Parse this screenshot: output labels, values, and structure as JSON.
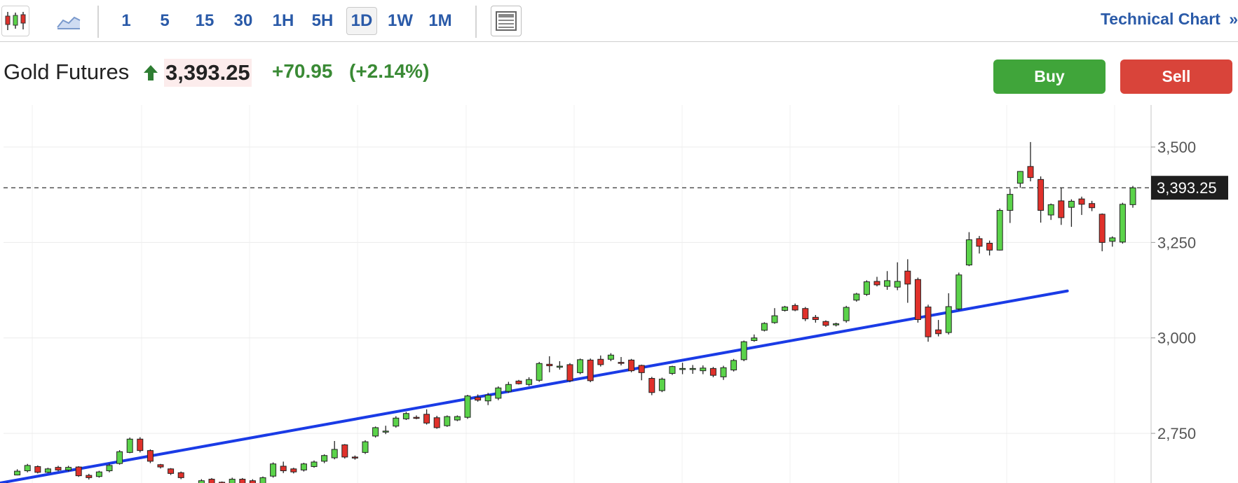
{
  "toolbar": {
    "candles_icon": "candlestick-icon",
    "area_icon": "area-chart-icon",
    "timeframes": [
      "1",
      "5",
      "15",
      "30",
      "1H",
      "5H",
      "1D",
      "1W",
      "1M"
    ],
    "active_timeframe": "1D",
    "layout_icon": "layout-icon",
    "technical_label": "Technical Chart",
    "technical_arrow": "»"
  },
  "header": {
    "title": "Gold Futures",
    "price": "3,393.25",
    "change": "+70.95",
    "change_pct": "(+2.14%)",
    "buy_label": "Buy",
    "sell_label": "Sell"
  },
  "colors": {
    "up": "#5bd34a",
    "down": "#e0312b",
    "trendline": "#1a3be6",
    "accent": "#2a5aa8"
  },
  "chart_data": {
    "type": "candlestick",
    "current_price": 3393.25,
    "current_price_label": "3,393.25",
    "y_ticks": [
      2750,
      3000,
      3250,
      3500
    ],
    "y_tick_labels": [
      "2,750",
      "3,000",
      "3,250",
      "3,500"
    ],
    "ylim": [
      2620,
      3610
    ],
    "trendline": {
      "start": [
        0,
        2620
      ],
      "end": [
        81,
        3123
      ]
    },
    "candles": [
      [
        2617,
        2619,
        2610,
        2621
      ],
      [
        2641,
        2651,
        2640,
        2656
      ],
      [
        2652,
        2666,
        2648,
        2670
      ],
      [
        2663,
        2648,
        2645,
        2666
      ],
      [
        2648,
        2657,
        2646,
        2660
      ],
      [
        2661,
        2654,
        2651,
        2665
      ],
      [
        2654,
        2661,
        2650,
        2665
      ],
      [
        2662,
        2639,
        2636,
        2664
      ],
      [
        2640,
        2634,
        2629,
        2644
      ],
      [
        2637,
        2649,
        2634,
        2652
      ],
      [
        2652,
        2666,
        2648,
        2671
      ],
      [
        2671,
        2702,
        2668,
        2706
      ],
      [
        2700,
        2735,
        2698,
        2739
      ],
      [
        2735,
        2705,
        2700,
        2740
      ],
      [
        2705,
        2677,
        2672,
        2708
      ],
      [
        2668,
        2662,
        2658,
        2670
      ],
      [
        2657,
        2645,
        2641,
        2659
      ],
      [
        2647,
        2634,
        2630,
        2650
      ],
      [
        2612,
        2607,
        2600,
        2615
      ],
      [
        2609,
        2626,
        2606,
        2630
      ],
      [
        2630,
        2617,
        2614,
        2633
      ],
      [
        2622,
        2620,
        2618,
        2624
      ],
      [
        2617,
        2630,
        2614,
        2634
      ],
      [
        2630,
        2610,
        2606,
        2633
      ],
      [
        2626,
        2608,
        2604,
        2630
      ],
      [
        2611,
        2634,
        2606,
        2637
      ],
      [
        2638,
        2670,
        2634,
        2674
      ],
      [
        2664,
        2652,
        2646,
        2676
      ],
      [
        2657,
        2649,
        2645,
        2660
      ],
      [
        2654,
        2670,
        2650,
        2673
      ],
      [
        2663,
        2675,
        2660,
        2679
      ],
      [
        2677,
        2692,
        2672,
        2695
      ],
      [
        2686,
        2708,
        2682,
        2730
      ],
      [
        2720,
        2688,
        2684,
        2722
      ],
      [
        2688,
        2686,
        2681,
        2692
      ],
      [
        2700,
        2728,
        2696,
        2732
      ],
      [
        2743,
        2765,
        2739,
        2768
      ],
      [
        2756,
        2756,
        2748,
        2770
      ],
      [
        2769,
        2790,
        2765,
        2795
      ],
      [
        2788,
        2802,
        2785,
        2806
      ],
      [
        2792,
        2790,
        2787,
        2797
      ],
      [
        2800,
        2777,
        2773,
        2813
      ],
      [
        2791,
        2765,
        2762,
        2796
      ],
      [
        2770,
        2794,
        2767,
        2797
      ],
      [
        2785,
        2794,
        2782,
        2797
      ],
      [
        2792,
        2848,
        2788,
        2851
      ],
      [
        2844,
        2837,
        2833,
        2852
      ],
      [
        2835,
        2850,
        2824,
        2856
      ],
      [
        2842,
        2869,
        2837,
        2873
      ],
      [
        2860,
        2878,
        2856,
        2885
      ],
      [
        2887,
        2880,
        2878,
        2890
      ],
      [
        2878,
        2891,
        2874,
        2897
      ],
      [
        2889,
        2933,
        2885,
        2937
      ],
      [
        2931,
        2927,
        2910,
        2952
      ],
      [
        2926,
        2926,
        2917,
        2939
      ],
      [
        2930,
        2888,
        2884,
        2934
      ],
      [
        2909,
        2943,
        2905,
        2946
      ],
      [
        2942,
        2888,
        2884,
        2946
      ],
      [
        2944,
        2930,
        2925,
        2954
      ],
      [
        2944,
        2955,
        2939,
        2960
      ],
      [
        2936,
        2935,
        2928,
        2950
      ],
      [
        2942,
        2914,
        2910,
        2945
      ],
      [
        2928,
        2909,
        2889,
        2930
      ],
      [
        2894,
        2857,
        2850,
        2898
      ],
      [
        2862,
        2892,
        2858,
        2896
      ],
      [
        2907,
        2925,
        2903,
        2927
      ],
      [
        2919,
        2920,
        2905,
        2935
      ],
      [
        2920,
        2920,
        2906,
        2929
      ],
      [
        2914,
        2921,
        2905,
        2928
      ],
      [
        2920,
        2902,
        2897,
        2924
      ],
      [
        2898,
        2922,
        2890,
        2927
      ],
      [
        2916,
        2941,
        2912,
        2945
      ],
      [
        2943,
        2990,
        2939,
        2993
      ],
      [
        2993,
        3000,
        2990,
        3009
      ],
      [
        3020,
        3038,
        3017,
        3041
      ],
      [
        3040,
        3058,
        3037,
        3078
      ],
      [
        3072,
        3081,
        3069,
        3084
      ],
      [
        3085,
        3073,
        3070,
        3090
      ],
      [
        3077,
        3050,
        3044,
        3081
      ],
      [
        3054,
        3048,
        3040,
        3060
      ],
      [
        3043,
        3033,
        3029,
        3046
      ],
      [
        3034,
        3037,
        3030,
        3040
      ],
      [
        3045,
        3080,
        3040,
        3084
      ],
      [
        3099,
        3115,
        3095,
        3118
      ],
      [
        3114,
        3147,
        3110,
        3151
      ],
      [
        3148,
        3139,
        3135,
        3160
      ],
      [
        3135,
        3150,
        3126,
        3175
      ],
      [
        3133,
        3148,
        3125,
        3198
      ],
      [
        3175,
        3141,
        3092,
        3206
      ],
      [
        3153,
        3048,
        3040,
        3158
      ],
      [
        3081,
        3003,
        2990,
        3087
      ],
      [
        3021,
        3011,
        3004,
        3047
      ],
      [
        3014,
        3082,
        3009,
        3117
      ],
      [
        3076,
        3165,
        3072,
        3171
      ],
      [
        3191,
        3257,
        3188,
        3277
      ],
      [
        3260,
        3240,
        3221,
        3267
      ],
      [
        3248,
        3230,
        3216,
        3255
      ],
      [
        3230,
        3334,
        3229,
        3339
      ],
      [
        3334,
        3376,
        3301,
        3391
      ],
      [
        3405,
        3436,
        3393,
        3437
      ],
      [
        3449,
        3420,
        3410,
        3513
      ],
      [
        3415,
        3334,
        3302,
        3423
      ],
      [
        3322,
        3349,
        3309,
        3352
      ],
      [
        3359,
        3315,
        3296,
        3393
      ],
      [
        3342,
        3358,
        3291,
        3363
      ],
      [
        3364,
        3350,
        3322,
        3370
      ],
      [
        3352,
        3341,
        3332,
        3359
      ],
      [
        3324,
        3250,
        3227,
        3326
      ],
      [
        3253,
        3262,
        3239,
        3266
      ],
      [
        3251,
        3350,
        3247,
        3354
      ],
      [
        3349,
        3393,
        3341,
        3398
      ]
    ]
  }
}
